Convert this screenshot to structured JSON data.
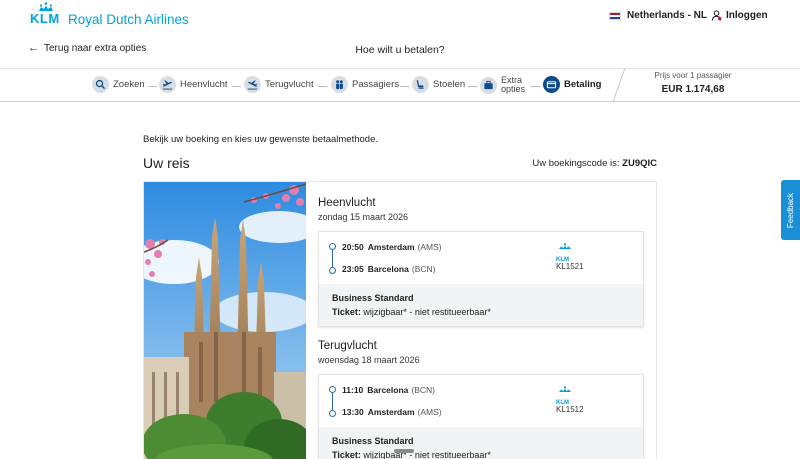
{
  "header": {
    "logo_text": "KLM",
    "brand_name": "Royal Dutch Airlines",
    "locale": "Netherlands - NL",
    "login": "Inloggen",
    "back_link": "Terug naar extra opties",
    "page_title": "Hoe wilt u betalen?"
  },
  "stepper": {
    "steps": [
      {
        "label": "Zoeken",
        "icon": "search-icon"
      },
      {
        "label": "Heenvlucht",
        "icon": "plane-departure-icon"
      },
      {
        "label": "Terugvlucht",
        "icon": "plane-arrival-icon"
      },
      {
        "label": "Passagiers",
        "icon": "passengers-icon"
      },
      {
        "label": "Stoelen",
        "icon": "seat-icon"
      },
      {
        "label": "Extra opties",
        "label_line1": "Extra",
        "label_line2": "opties",
        "icon": "briefcase-icon"
      },
      {
        "label": "Betaling",
        "icon": "payment-card-icon",
        "active": true
      }
    ],
    "price_label": "Prijs voor 1 passagier",
    "price_value": "EUR 1.174,68"
  },
  "main": {
    "intro": "Bekijk uw boeking en kies uw gewenste betaalmethode.",
    "trip_title": "Uw reis",
    "booking_code_label": "Uw boekingscode is:",
    "booking_code": "ZU9QIC",
    "flights": [
      {
        "title": "Heenvlucht",
        "date": "zondag 15 maart 2026",
        "departure": {
          "time": "20:50",
          "city": "Amsterdam",
          "code": "(AMS)"
        },
        "arrival": {
          "time": "23:05",
          "city": "Barcelona",
          "code": "(BCN)"
        },
        "carrier_logo": "KLM",
        "flight_number": "KL1521",
        "fare_class": "Business Standard",
        "ticket_label": "Ticket:",
        "ticket_value": "wijzigbaar* - niet restitueerbaar*"
      },
      {
        "title": "Terugvlucht",
        "date": "woensdag 18 maart 2026",
        "departure": {
          "time": "11:10",
          "city": "Barcelona",
          "code": "(BCN)"
        },
        "arrival": {
          "time": "13:30",
          "city": "Amsterdam",
          "code": "(AMS)"
        },
        "carrier_logo": "KLM",
        "flight_number": "KL1512",
        "fare_class": "Business Standard",
        "ticket_label": "Ticket:",
        "ticket_value": "wijzigbaar* - niet restitueerbaar*"
      }
    ]
  },
  "feedback_tab": "Feedback",
  "colors": {
    "brand": "#00a1de",
    "active_step": "#0e4a8c",
    "timeline": "#2a6db5",
    "feedback": "#1a8fd6"
  }
}
